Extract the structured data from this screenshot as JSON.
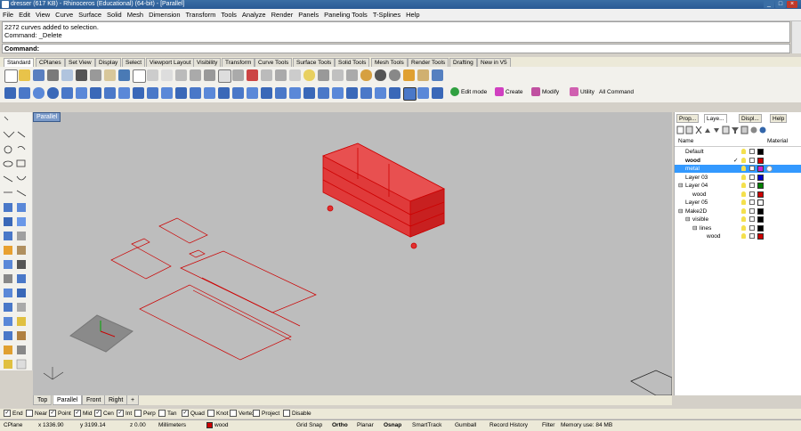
{
  "window": {
    "title": "dresser (617 KB) - Rhinoceros (Educational) (64-bit) - [Parallel]"
  },
  "menu": [
    "File",
    "Edit",
    "View",
    "Curve",
    "Surface",
    "Solid",
    "Mesh",
    "Dimension",
    "Transform",
    "Tools",
    "Analyze",
    "Render",
    "Panels",
    "Paneling Tools",
    "T-Splines",
    "Help"
  ],
  "history": {
    "line1": "2272 curves added to selection.",
    "line2": "Command: _Delete"
  },
  "command": {
    "label": "Command:"
  },
  "toolbar_tabs": [
    "Standard",
    "CPlanes",
    "Set View",
    "Display",
    "Select",
    "Viewport Layout",
    "Visibility",
    "Transform",
    "Curve Tools",
    "Surface Tools",
    "Solid Tools",
    "Mesh Tools",
    "Render Tools",
    "Drafting",
    "New in V5"
  ],
  "tsplines_groups": [
    "Edit mode",
    "Create",
    "Modify",
    "Utility",
    "All Command"
  ],
  "viewport": {
    "label": "Parallel",
    "tabs": [
      "Top",
      "Parallel",
      "Front",
      "Right"
    ]
  },
  "panel": {
    "tabs": [
      "Prop...",
      "Laye...",
      "Displ...",
      "Help"
    ],
    "columns": {
      "name": "Name",
      "material": "Material"
    },
    "layers": [
      {
        "name": "Default",
        "bold": false,
        "indent": 0,
        "color": "#000000",
        "check": "",
        "selected": false
      },
      {
        "name": "wood",
        "bold": true,
        "indent": 0,
        "color": "#cc0000",
        "check": "✓",
        "selected": false
      },
      {
        "name": "metal",
        "bold": false,
        "indent": 0,
        "color": "#d020d0",
        "check": "",
        "selected": true
      },
      {
        "name": "Layer 03",
        "bold": false,
        "indent": 0,
        "color": "#0000cc",
        "check": "",
        "selected": false
      },
      {
        "name": "Layer 04",
        "bold": false,
        "indent": 0,
        "color": "#008000",
        "check": "",
        "selected": false,
        "expand": "⊟"
      },
      {
        "name": "wood",
        "bold": false,
        "indent": 1,
        "color": "#cc0000",
        "check": "",
        "selected": false
      },
      {
        "name": "Layer 05",
        "bold": false,
        "indent": 0,
        "color": "#ffffff",
        "check": "",
        "selected": false
      },
      {
        "name": "Make2D",
        "bold": false,
        "indent": 0,
        "color": "#000000",
        "check": "",
        "selected": false,
        "expand": "⊟"
      },
      {
        "name": "visible",
        "bold": false,
        "indent": 1,
        "color": "#000000",
        "check": "",
        "selected": false,
        "expand": "⊟"
      },
      {
        "name": "lines",
        "bold": false,
        "indent": 2,
        "color": "#000000",
        "check": "",
        "selected": false,
        "expand": "⊟"
      },
      {
        "name": "wood",
        "bold": false,
        "indent": 3,
        "color": "#cc0000",
        "check": "",
        "selected": false
      }
    ]
  },
  "osnaps": [
    {
      "label": "End",
      "checked": true
    },
    {
      "label": "Near",
      "checked": false
    },
    {
      "label": "Point",
      "checked": true
    },
    {
      "label": "Mid",
      "checked": true
    },
    {
      "label": "Cen",
      "checked": true
    },
    {
      "label": "Int",
      "checked": true
    },
    {
      "label": "Perp",
      "checked": false
    },
    {
      "label": "Tan",
      "checked": false
    },
    {
      "label": "Quad",
      "checked": true
    },
    {
      "label": "Knot",
      "checked": false
    },
    {
      "label": "Vertex",
      "checked": false
    },
    {
      "label": "Project",
      "checked": false
    },
    {
      "label": "Disable",
      "checked": false
    }
  ],
  "status": {
    "cplane": "CPlane",
    "x": "x 1336.90",
    "y": "y 3199.14",
    "z": "z 0.00",
    "units": "Millimeters",
    "layer": "wood",
    "layer_color": "#cc0000",
    "toggles": [
      "Grid Snap",
      "Ortho",
      "Planar",
      "Osnap",
      "SmartTrack",
      "Gumball",
      "Record History",
      "Filter"
    ],
    "memory": "Memory use: 84 MB"
  },
  "colors": {
    "accent": "#3399ff",
    "curve": "#cc0000",
    "viewport_bg": "#bdbdbd"
  }
}
